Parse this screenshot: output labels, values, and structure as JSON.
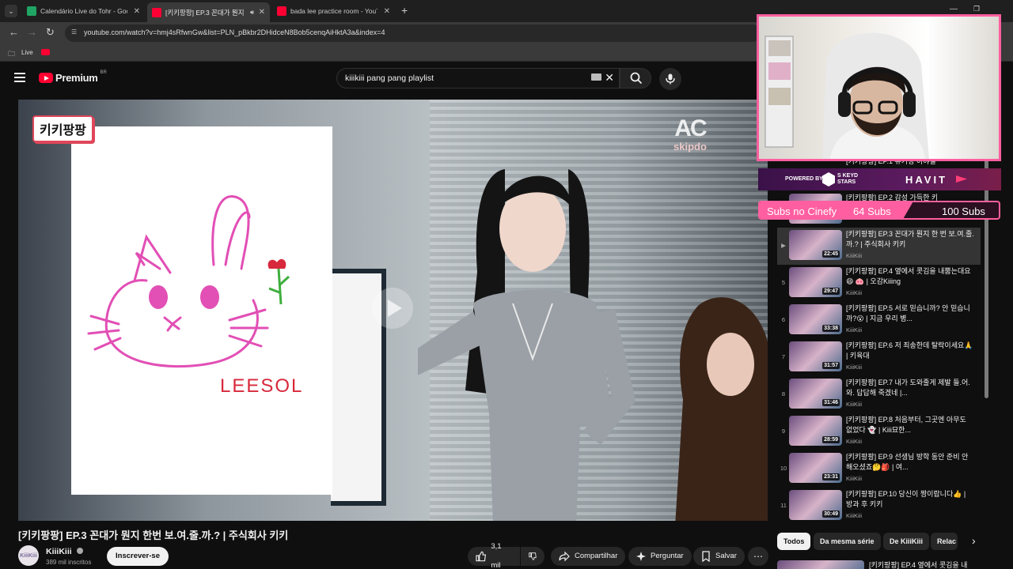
{
  "browser": {
    "tabs": [
      {
        "title": "Calendário Live do Tohr - Goog",
        "favicon": "sheets-icon"
      },
      {
        "title": "[키키팡팡] EP.3 꼰대가 뭔지",
        "favicon": "youtube-icon"
      },
      {
        "title": "bada lee practice room - YouTu",
        "favicon": "youtube-icon"
      }
    ],
    "url": "youtube.com/watch?v=hmj4sRfwnGw&list=PLN_pBkbr2DHidceN8Bob5cenqAiHktA3a&index=4",
    "bookmarks": {
      "folder": "Live"
    }
  },
  "header": {
    "logo_text": "Premium",
    "region": "BR",
    "search_value": "kiiikiii pang pang playlist"
  },
  "video": {
    "overlay_tag": "키키팡팡",
    "drawing_signature": "LEESOL",
    "watermark": "skipdo",
    "title": "[키키팡팡] EP.3 꼰대가 뭔지 한번 보.여.줄.까.? | 주식회사 키키",
    "channel": {
      "name": "KiiiKiii",
      "avatar_text": "KiiiKiii",
      "subs": "389 mil inscritos",
      "subscribe_label": "Inscrever-se"
    },
    "actions": {
      "likes": "3,1 mil",
      "share": "Compartilhar",
      "ask": "Perguntar",
      "save": "Salvar"
    }
  },
  "playlist": {
    "partial_top": [
      {
        "title": "[키키팡팡] EP.1 뮤기정 이야일"
      },
      {
        "title": "[키키팡팡] EP.2 감성 가득한 키"
      }
    ],
    "items": [
      {
        "index": "▶",
        "title": "[키키팡팡] EP.3 꼰대가 뭔지 한 번 보.여.줄.까.? | 주식회사 키키",
        "channel": "KiiiKiii",
        "duration": "22:45",
        "active": true
      },
      {
        "index": "5",
        "title": "[키키팡팡] EP.4 옆에서 콧김을 내뿜는대요😄 🐽 | 오감Kiiing",
        "channel": "KiiiKiii",
        "duration": "29:47"
      },
      {
        "index": "6",
        "title": "[키키팡팡] EP.5 서로 믿습니까? 안 믿습니까?😮 | 지금 우리 병...",
        "channel": "KiiiKiii",
        "duration": "33:38"
      },
      {
        "index": "7",
        "title": "[키키팡팡] EP.6 저 죄송한데 탈락이세요🙏 | 키육대",
        "channel": "KiiiKiii",
        "duration": "31:57"
      },
      {
        "index": "8",
        "title": "[키키팡팡] EP.7 내가 도와줄게 제발 들.어.와. 답답해 죽겠네 |...",
        "channel": "KiiiKiii",
        "duration": "31:46"
      },
      {
        "index": "9",
        "title": "[키키팡팡] EP.8 처음부터, 그곳엔 아무도 없었다 👻 | Kiii묘한...",
        "channel": "KiiiKiii",
        "duration": "28:59"
      },
      {
        "index": "10",
        "title": "[키키팡팡] EP.9 선생님 방학 동안 준비 안 해오셨죠🤔🎒 | 여...",
        "channel": "KiiiKiii",
        "duration": "23:31"
      },
      {
        "index": "11",
        "title": "[키키팡팡] EP.10 당신이 짱이랍니다👍 | 방과 후 키키",
        "channel": "KiiiKiii",
        "duration": "30:49"
      }
    ]
  },
  "chips": [
    "Todos",
    "Da mesma série",
    "De KiiiKiii",
    "Relac"
  ],
  "next_item_title": "[키키팡팡] EP.4 옆에서 콧김을 내",
  "overlay": {
    "powered_by": "POWERED BY",
    "sponsor1": "S KEYD STARS",
    "sponsor2": "HAVIT",
    "subs_label": "Subs no Cinefy",
    "subs_current": "64 Subs",
    "subs_goal": "100 Subs",
    "subs_progress": 0.64,
    "accent": "#ff5fa0"
  },
  "colors": {
    "brand": "#ff0033",
    "bg": "#0f0f0f"
  }
}
